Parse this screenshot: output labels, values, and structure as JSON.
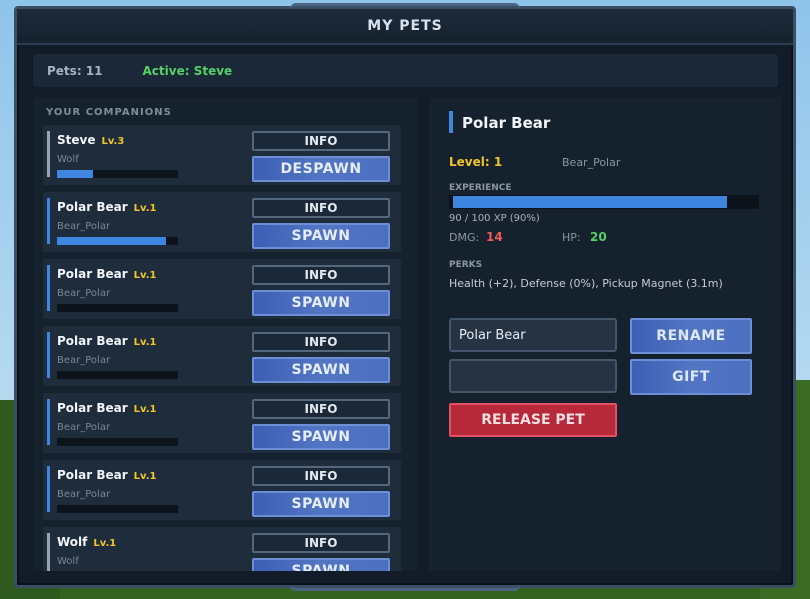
{
  "window": {
    "title": "MY PETS"
  },
  "status": {
    "pets_count": "Pets: 11",
    "active": "Active: Steve"
  },
  "companions": {
    "label": "YOUR COMPANIONS",
    "scroll_position": 0.0,
    "items": [
      {
        "name": "Steve",
        "level": "Lv.3",
        "type": "Wolf",
        "xp_fraction": 0.3,
        "accent": "grey",
        "info_label": "INFO",
        "action_label": "DESPAWN"
      },
      {
        "name": "Polar Bear",
        "level": "Lv.1",
        "type": "Bear_Polar",
        "xp_fraction": 0.9,
        "accent": "blue",
        "info_label": "INFO",
        "action_label": "SPAWN"
      },
      {
        "name": "Polar Bear",
        "level": "Lv.1",
        "type": "Bear_Polar",
        "xp_fraction": 0.0,
        "accent": "blue",
        "info_label": "INFO",
        "action_label": "SPAWN"
      },
      {
        "name": "Polar Bear",
        "level": "Lv.1",
        "type": "Bear_Polar",
        "xp_fraction": 0.0,
        "accent": "blue",
        "info_label": "INFO",
        "action_label": "SPAWN"
      },
      {
        "name": "Polar Bear",
        "level": "Lv.1",
        "type": "Bear_Polar",
        "xp_fraction": 0.0,
        "accent": "blue",
        "info_label": "INFO",
        "action_label": "SPAWN"
      },
      {
        "name": "Polar Bear",
        "level": "Lv.1",
        "type": "Bear_Polar",
        "xp_fraction": 0.0,
        "accent": "blue",
        "info_label": "INFO",
        "action_label": "SPAWN"
      },
      {
        "name": "Wolf",
        "level": "Lv.1",
        "type": "Wolf",
        "xp_fraction": 0.0,
        "accent": "grey",
        "info_label": "INFO",
        "action_label": "SPAWN"
      }
    ]
  },
  "details": {
    "name": "Polar Bear",
    "level": "Level: 1",
    "species": "Bear_Polar",
    "experience_label": "EXPERIENCE",
    "xp_fraction": 0.9,
    "xp_text": "90 / 100 XP (90%)",
    "dmg_label": "DMG:",
    "dmg_value": "14",
    "hp_label": "HP:",
    "hp_value": "20",
    "perks_label": "PERKS",
    "perks": "Health (+2), Defense (0%), Pickup Magnet (3.1m)",
    "rename_value": "Polar Bear",
    "gift_value": "",
    "rename_label": "RENAME",
    "gift_label": "GIFT",
    "release_label": "RELEASE PET"
  },
  "colors": {
    "accent_blue": "#3f86e0",
    "level_yellow": "#f2c628",
    "active_green": "#58d068",
    "dmg_red": "#ef5a5a",
    "release_red": "#b8283b"
  }
}
